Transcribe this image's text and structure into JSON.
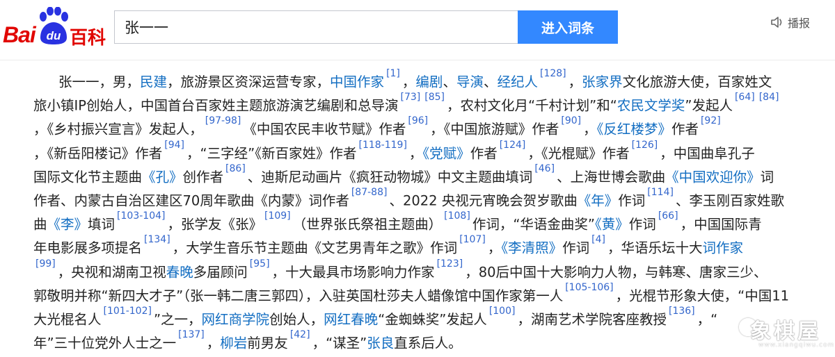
{
  "header": {
    "logo_bai": "Bai",
    "logo_du": "du",
    "logo_baike": "百科",
    "search_value": "张一一",
    "search_button": "进入词条",
    "voice_label": "播报",
    "brand_color": "#e10602",
    "button_color": "#3388ff"
  },
  "article": {
    "lines": [
      [
        {
          "t": "张一一，男，"
        },
        {
          "t": "民建",
          "link": true
        },
        {
          "t": "，旅游景区资深运营专家，"
        },
        {
          "t": "中国作家",
          "link": true
        },
        {
          "t": "[1]",
          "ref": true
        },
        {
          "t": "，"
        },
        {
          "t": "编剧",
          "link": true
        },
        {
          "t": "、"
        },
        {
          "t": "导演",
          "link": true
        },
        {
          "t": "、"
        },
        {
          "t": "经纪人",
          "link": true
        },
        {
          "t": "[128]",
          "ref": true
        },
        {
          "t": "，"
        },
        {
          "t": "张家界",
          "link": true
        },
        {
          "t": "文化旅游大使，百家姓文"
        }
      ],
      [
        {
          "t": "旅小镇IP创始人，中国首台百家姓主题旅游演艺编剧和总导演"
        },
        {
          "t": "[73]",
          "ref": true
        },
        {
          "t": "[85]",
          "ref": true
        },
        {
          "t": "，农村文化月“千村计划”和“"
        },
        {
          "t": "农民文学奖",
          "link": true
        },
        {
          "t": "”发起人"
        },
        {
          "t": "[64]",
          "ref": true
        },
        {
          "t": "[84]",
          "ref": true
        }
      ],
      [
        {
          "t": "，《乡村振兴宣言》发起人，"
        },
        {
          "t": "[97-98]",
          "ref": true
        },
        {
          "t": "《中国农民丰收节赋》作者"
        },
        {
          "t": "[96]",
          "ref": true
        },
        {
          "t": "，《中国旅游赋》作者"
        },
        {
          "t": "[90]",
          "ref": true
        },
        {
          "t": "，"
        },
        {
          "t": "《反红楼梦》",
          "link": true
        },
        {
          "t": "作者"
        },
        {
          "t": "[92]",
          "ref": true
        }
      ],
      [
        {
          "t": "，《新岳阳楼记》作者"
        },
        {
          "t": "[94]",
          "ref": true
        },
        {
          "t": "，“三字经”《新百家姓》作者"
        },
        {
          "t": "[118-119]",
          "ref": true
        },
        {
          "t": "，"
        },
        {
          "t": "《党赋》",
          "link": true
        },
        {
          "t": "作者"
        },
        {
          "t": "[124]",
          "ref": true
        },
        {
          "t": "，《光棍赋》作者"
        },
        {
          "t": "[126]",
          "ref": true
        },
        {
          "t": "，中国曲阜孔子"
        }
      ],
      [
        {
          "t": "国际文化节主题曲"
        },
        {
          "t": "《孔》",
          "link": true
        },
        {
          "t": "创作者"
        },
        {
          "t": "[86]",
          "ref": true
        },
        {
          "t": "、迪斯尼动画片《疯狂动物城》中文主题曲填词"
        },
        {
          "t": "[46]",
          "ref": true
        },
        {
          "t": "、上海世博会歌曲"
        },
        {
          "t": "《中国欢迎你》",
          "link": true
        },
        {
          "t": "词"
        }
      ],
      [
        {
          "t": "作者、内蒙古自治区建区70周年歌曲《内蒙》词作者"
        },
        {
          "t": "[87-88]",
          "ref": true
        },
        {
          "t": "、2022 央视元宵晚会贺岁歌曲"
        },
        {
          "t": "《年》",
          "link": true
        },
        {
          "t": "作词"
        },
        {
          "t": "[114]",
          "ref": true
        },
        {
          "t": "、李玉刚百家姓歌"
        }
      ],
      [
        {
          "t": "曲"
        },
        {
          "t": "《李》",
          "link": true
        },
        {
          "t": "填词"
        },
        {
          "t": "[103-104]",
          "ref": true
        },
        {
          "t": "，张学友《张》"
        },
        {
          "t": "[109]",
          "ref": true
        },
        {
          "t": "（世界张氏祭祖主题曲）"
        },
        {
          "t": "[108]",
          "ref": true
        },
        {
          "t": "作词，“华语金曲奖”"
        },
        {
          "t": "《黄》",
          "link": true
        },
        {
          "t": "作词"
        },
        {
          "t": "[66]",
          "ref": true
        },
        {
          "t": "，中国国际青"
        }
      ],
      [
        {
          "t": "年电影展多项提名"
        },
        {
          "t": "[134]",
          "ref": true
        },
        {
          "t": "，大学生音乐节主题曲《文艺男青年之歌》作词"
        },
        {
          "t": "[107]",
          "ref": true
        },
        {
          "t": "，"
        },
        {
          "t": "《李清照》",
          "link": true
        },
        {
          "t": "作词"
        },
        {
          "t": "[4]",
          "ref": true
        },
        {
          "t": "，华语乐坛十大"
        },
        {
          "t": "词作家",
          "link": true
        }
      ],
      [
        {
          "t": "[99]",
          "ref": true
        },
        {
          "t": "，央视和湖南卫视"
        },
        {
          "t": "春晚",
          "link": true
        },
        {
          "t": "多届顾问"
        },
        {
          "t": "[95]",
          "ref": true
        },
        {
          "t": "，十大最具市场影响力作家"
        },
        {
          "t": "[123]",
          "ref": true
        },
        {
          "t": "，80后中国十大影响力人物，与韩寒、唐家三少、"
        }
      ],
      [
        {
          "t": "郭敬明并称“新四大才子”（张一韩二唐三郭四），入驻英国杜莎夫人蜡像馆中国作家第一人"
        },
        {
          "t": "[105-106]",
          "ref": true
        },
        {
          "t": "，光棍节形象大使，“中国11"
        }
      ],
      [
        {
          "t": "大光棍名人"
        },
        {
          "t": "[101-102]",
          "ref": true
        },
        {
          "t": "”之一，"
        },
        {
          "t": "网红商学院",
          "link": true
        },
        {
          "t": "创始人，"
        },
        {
          "t": "网红春晚",
          "link": true
        },
        {
          "t": "“金蜘蛛奖”发起人"
        },
        {
          "t": "[100]",
          "ref": true
        },
        {
          "t": "，湖南艺术学院客座教授"
        },
        {
          "t": "[136]",
          "ref": true
        },
        {
          "t": "，“"
        }
      ],
      [
        {
          "t": "年”三十位党外人士之一"
        },
        {
          "t": "[137]",
          "ref": true
        },
        {
          "t": "，"
        },
        {
          "t": "柳岩",
          "link": true
        },
        {
          "t": "前男友"
        },
        {
          "t": "[42]",
          "ref": true
        },
        {
          "t": "，“谋圣”"
        },
        {
          "t": "张良",
          "link": true
        },
        {
          "t": "直系后人。"
        }
      ]
    ]
  },
  "watermark": {
    "text": "象棋屋",
    "url": "www.xiangqiwu.com"
  }
}
